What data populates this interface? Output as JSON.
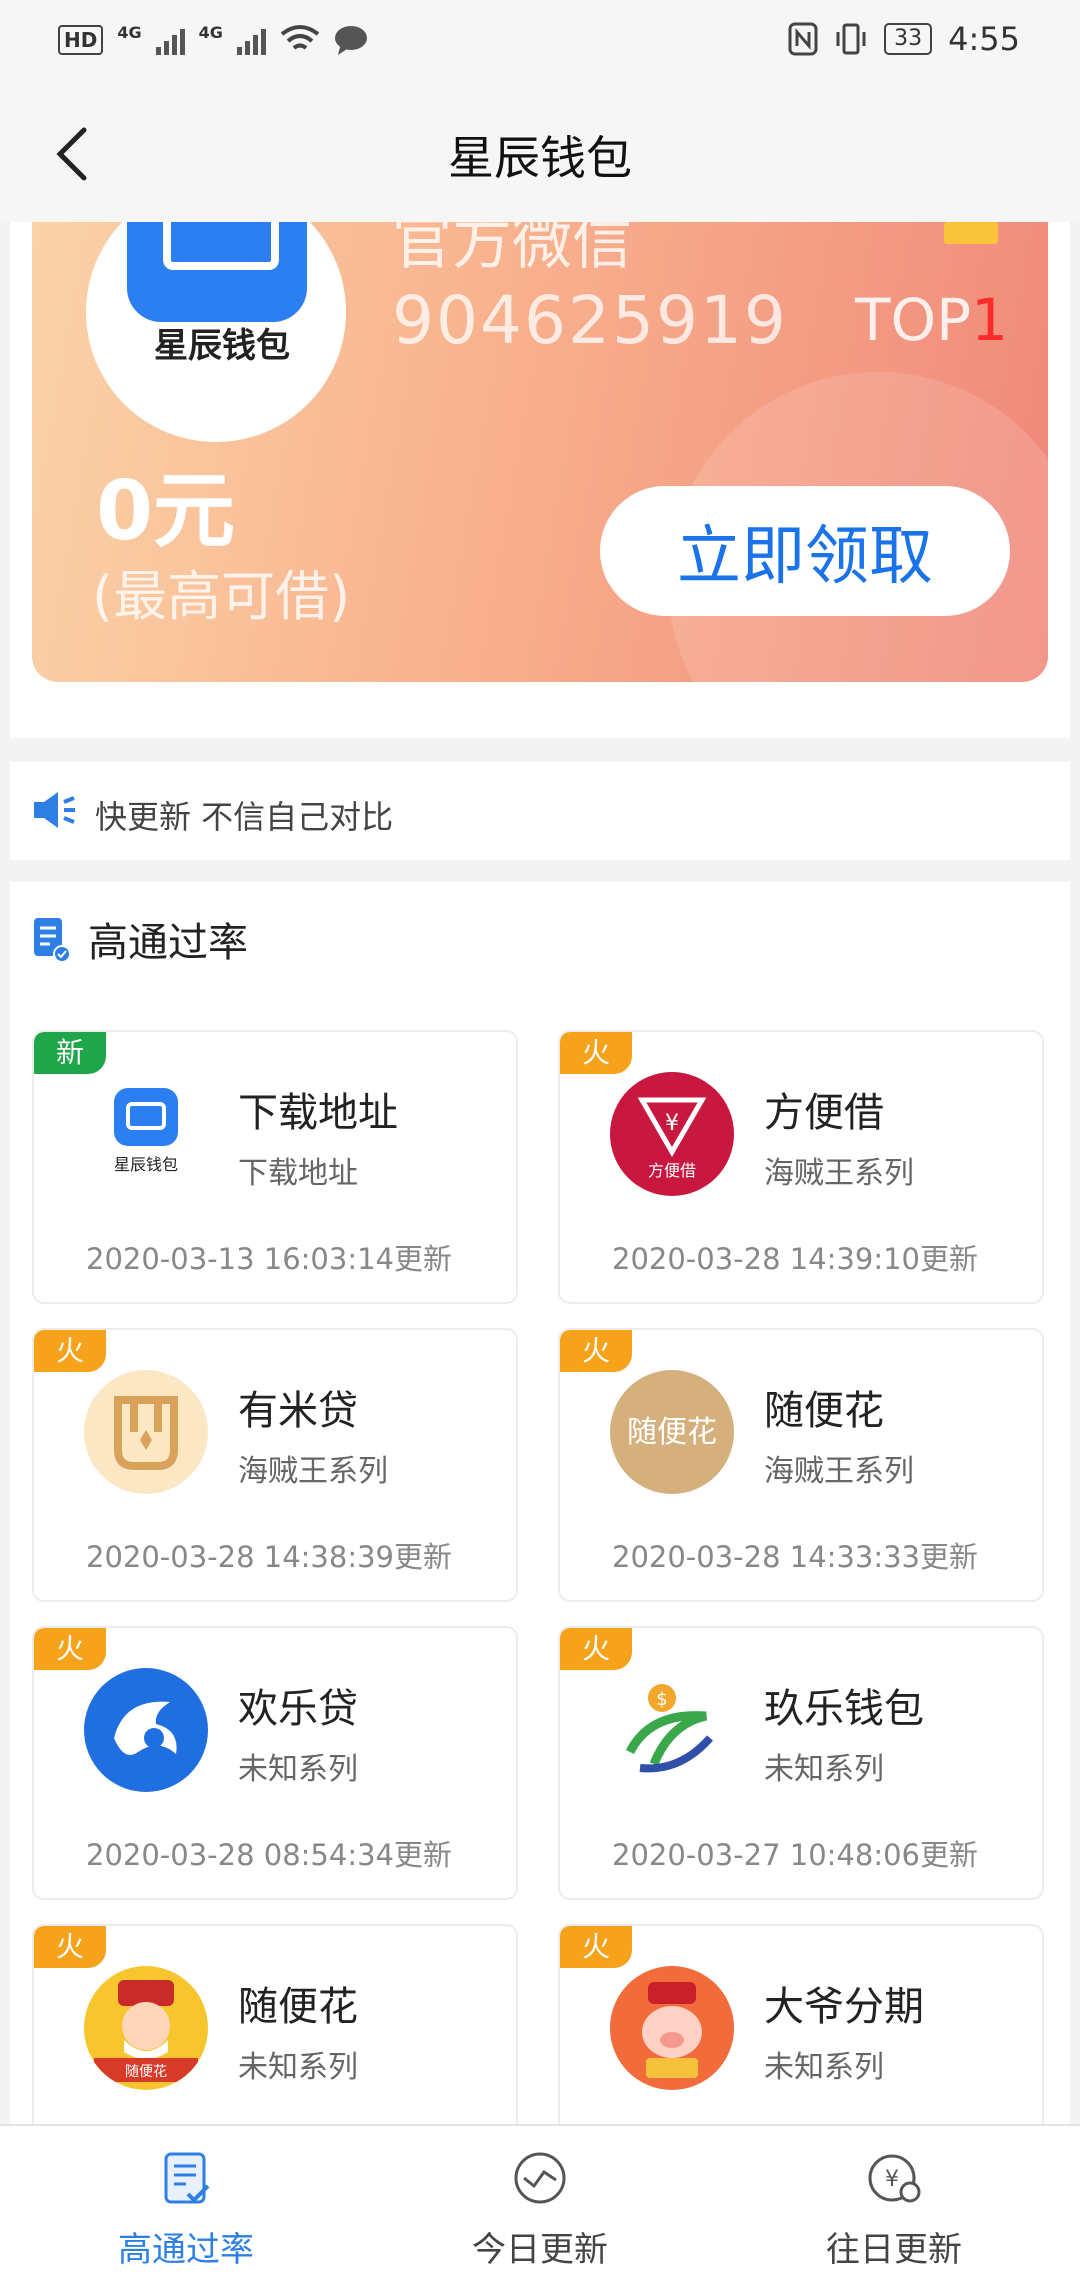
{
  "status_bar": {
    "hd": "HD",
    "net1": "4G",
    "net2": "4G",
    "battery": "33",
    "time": "4:55"
  },
  "header": {
    "title": "星辰钱包"
  },
  "banner": {
    "logo_text": "星辰钱包",
    "top_text": "官方微信",
    "number": "904625919",
    "top_label": "TOP",
    "top_rank": "1",
    "amount": "0元",
    "amount_sub": "(最高可借)",
    "button": "立即领取"
  },
  "marquee": {
    "text": "快更新 不信自己对比"
  },
  "section": {
    "title": "高通过率"
  },
  "cards": [
    {
      "tag": "新",
      "tag_type": "new",
      "name": "下载地址",
      "sub": "下载地址",
      "time": "2020-03-13 16:03:14更新",
      "logo_text": "星辰钱包",
      "icon": "wallet-app-icon"
    },
    {
      "tag": "火",
      "tag_type": "hot",
      "name": "方便借",
      "sub": "海贼王系列",
      "time": "2020-03-28 14:39:10更新",
      "logo_text": "方便借",
      "icon": "yen-triangle-icon"
    },
    {
      "tag": "火",
      "tag_type": "hot",
      "name": "有米贷",
      "sub": "海贼王系列",
      "time": "2020-03-28 14:38:39更新",
      "logo_text": "",
      "icon": "youmi-icon"
    },
    {
      "tag": "火",
      "tag_type": "hot",
      "name": "随便花",
      "sub": "海贼王系列",
      "time": "2020-03-28 14:33:33更新",
      "logo_text": "随便花",
      "icon": "suibianhua-icon"
    },
    {
      "tag": "火",
      "tag_type": "hot",
      "name": "欢乐贷",
      "sub": "未知系列",
      "time": "2020-03-28 08:54:34更新",
      "logo_text": "",
      "icon": "dolphin-icon"
    },
    {
      "tag": "火",
      "tag_type": "hot",
      "name": "玖乐钱包",
      "sub": "未知系列",
      "time": "2020-03-27 10:48:06更新",
      "logo_text": "",
      "icon": "coin-person-icon"
    },
    {
      "tag": "火",
      "tag_type": "hot",
      "name": "随便花",
      "sub": "未知系列",
      "time": "",
      "logo_text": "随便花",
      "icon": "fortune-god-icon"
    },
    {
      "tag": "火",
      "tag_type": "hot",
      "name": "大爷分期",
      "sub": "未知系列",
      "time": "",
      "logo_text": "",
      "icon": "pig-god-icon"
    }
  ],
  "bottom_nav": [
    {
      "label": "高通过率",
      "icon": "clipboard-check-icon",
      "active": true
    },
    {
      "label": "今日更新",
      "icon": "trend-circle-icon",
      "active": false
    },
    {
      "label": "往日更新",
      "icon": "yen-clock-icon",
      "active": false
    }
  ],
  "colors": {
    "accent": "#2d7fe3",
    "new_tag": "#1fa64a",
    "hot_tag": "#f7a21b",
    "banner_start": "#fbd3a8",
    "banner_end": "#f0887a"
  }
}
